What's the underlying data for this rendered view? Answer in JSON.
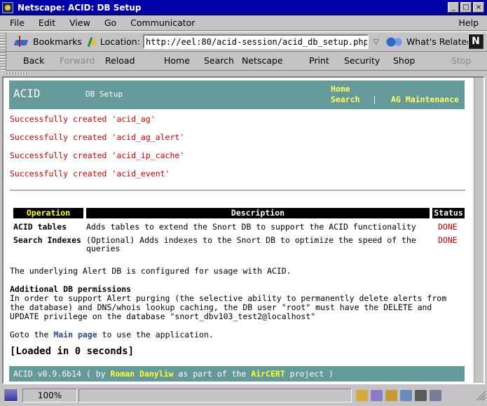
{
  "window": {
    "title": "Netscape: ACID: DB Setup"
  },
  "menubar": {
    "items": [
      "File",
      "Edit",
      "View",
      "Go",
      "Communicator"
    ],
    "help": "Help"
  },
  "locationbar": {
    "bookmarks_label": "Bookmarks",
    "location_label": "Location:",
    "url": "http://eel:80/acid-session/acid_db_setup.php",
    "whats_related": "What's Related",
    "logo_letter": "N"
  },
  "navbar": {
    "back": "Back",
    "forward": "Forward",
    "reload": "Reload",
    "home": "Home",
    "search": "Search",
    "netscape": "Netscape",
    "print": "Print",
    "security": "Security",
    "shop": "Shop",
    "stop": "Stop"
  },
  "page": {
    "header": {
      "brand": "ACID",
      "subtitle": "DB Setup",
      "home_link": "Home",
      "search_link": "Search",
      "separator": "|",
      "ag_link": "AG Maintenance"
    },
    "messages": [
      "Successfully created 'acid_ag'",
      "Successfully created 'acid_ag_alert'",
      "Successfully created 'acid_ip_cache'",
      "Successfully created 'acid_event'"
    ],
    "table": {
      "headers": [
        "Operation",
        "Description",
        "Status"
      ],
      "rows": [
        {
          "operation": "ACID tables",
          "description": "Adds tables to extend the Snort DB to support the ACID functionality",
          "status": "DONE"
        },
        {
          "operation": "Search Indexes",
          "description_line1": "(Optional) Adds indexes to the Snort DB to optimize the speed of the",
          "description_line2": "queries",
          "status": "DONE"
        }
      ]
    },
    "configured_text": "The underlying Alert DB is configured for usage with ACID.",
    "permissions": {
      "heading": "Additional DB permissions",
      "line1": "In order to support Alert purging (the selective ability to permanently delete alerts from",
      "line2": "the database) and DNS/whois lookup caching, the DB user \"root\" must have the DELETE and",
      "line3": "UPDATE privilege on the database \"snort_dbv103_test2@localhost\""
    },
    "goto": {
      "prefix": "Goto the",
      "link": "Main page",
      "suffix": "to use the application."
    },
    "loaded": "[Loaded in 0 seconds]",
    "footer": {
      "version": "ACID v0.9.6b14 ( by ",
      "author": "Roman Danyliw",
      "middle": " as part of the ",
      "project": "AirCERT",
      "end": " project )"
    }
  },
  "statusbar": {
    "percent": "100%"
  },
  "colors": {
    "titlebar": "#0000a8",
    "band": "#669999",
    "success_text": "#cc0000",
    "header_link": "#ffff66"
  }
}
